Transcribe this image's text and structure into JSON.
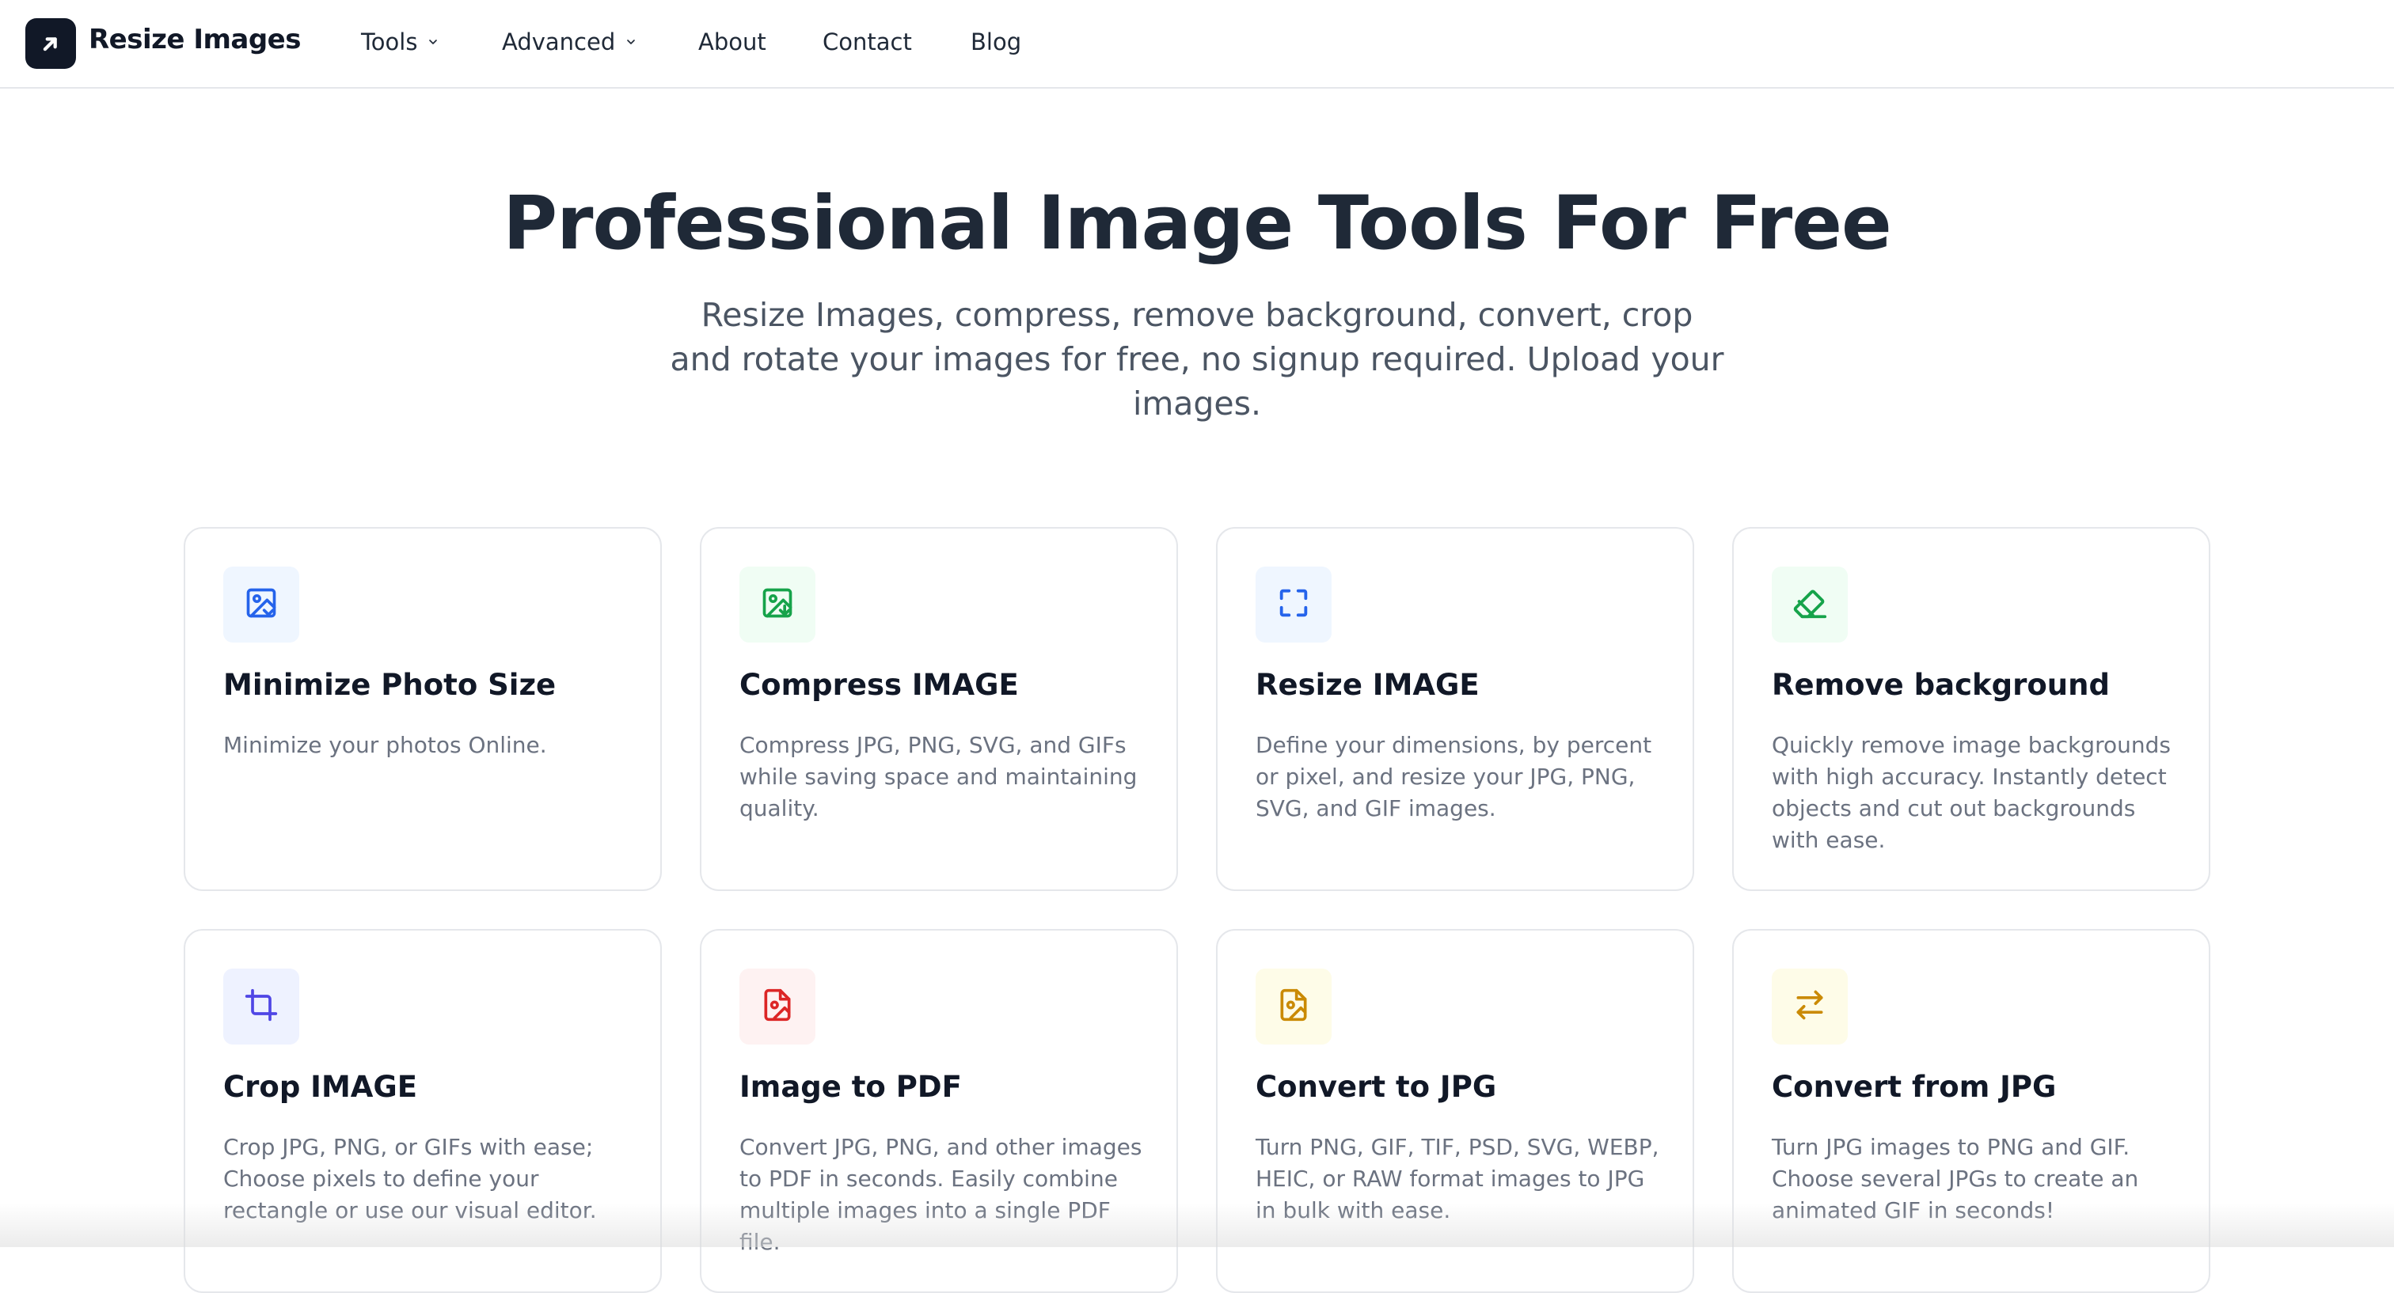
{
  "header": {
    "brand": "Resize Images",
    "brand_icon": "arrow-up-right-logo-icon",
    "nav": [
      {
        "label": "Tools",
        "has_dropdown": true
      },
      {
        "label": "Advanced",
        "has_dropdown": true
      },
      {
        "label": "About",
        "has_dropdown": false
      },
      {
        "label": "Contact",
        "has_dropdown": false
      },
      {
        "label": "Blog",
        "has_dropdown": false
      }
    ]
  },
  "hero": {
    "title": "Professional Image Tools For Free",
    "subtitle": "Resize Images, compress, remove background, convert, crop and rotate your images for free, no signup required. Upload your images."
  },
  "tools": [
    {
      "title": "Minimize Photo Size",
      "desc": "Minimize your photos Online.",
      "icon": "image-minimize-icon",
      "icon_color": "#2563eb",
      "icon_bg": "#eff6ff"
    },
    {
      "title": "Compress IMAGE",
      "desc": "Compress JPG, PNG, SVG, and GIFs while saving space and maintaining quality.",
      "icon": "image-compress-icon",
      "icon_color": "#16a34a",
      "icon_bg": "#f0fdf4"
    },
    {
      "title": "Resize IMAGE",
      "desc": "Define your dimensions, by percent or pixel, and resize your JPG, PNG, SVG, and GIF images.",
      "icon": "resize-frame-icon",
      "icon_color": "#2563eb",
      "icon_bg": "#eff6ff"
    },
    {
      "title": "Remove background",
      "desc": "Quickly remove image backgrounds with high accuracy. Instantly detect objects and cut out backgrounds with ease.",
      "icon": "eraser-icon",
      "icon_color": "#16a34a",
      "icon_bg": "#f0fdf4"
    },
    {
      "title": "Crop IMAGE",
      "desc": "Crop JPG, PNG, or GIFs with ease; Choose pixels to define your rectangle or use our visual editor.",
      "icon": "crop-icon",
      "icon_color": "#4f46e5",
      "icon_bg": "#eef2ff"
    },
    {
      "title": "Image to PDF",
      "desc": "Convert JPG, PNG, and other images to PDF in seconds. Easily combine multiple images into a single PDF file.",
      "icon": "file-image-pdf-icon",
      "icon_color": "#dc2626",
      "icon_bg": "#fef2f2"
    },
    {
      "title": "Convert to JPG",
      "desc": "Turn PNG, GIF, TIF, PSD, SVG, WEBP, HEIC, or RAW format images to JPG in bulk with ease.",
      "icon": "file-image-jpg-icon",
      "icon_color": "#ca8a04",
      "icon_bg": "#fefce8"
    },
    {
      "title": "Convert from JPG",
      "desc": "Turn JPG images to PNG and GIF. Choose several JPGs to create an animated GIF in seconds!",
      "icon": "arrows-swap-icon",
      "icon_color": "#ca8a04",
      "icon_bg": "#fefce8"
    }
  ]
}
